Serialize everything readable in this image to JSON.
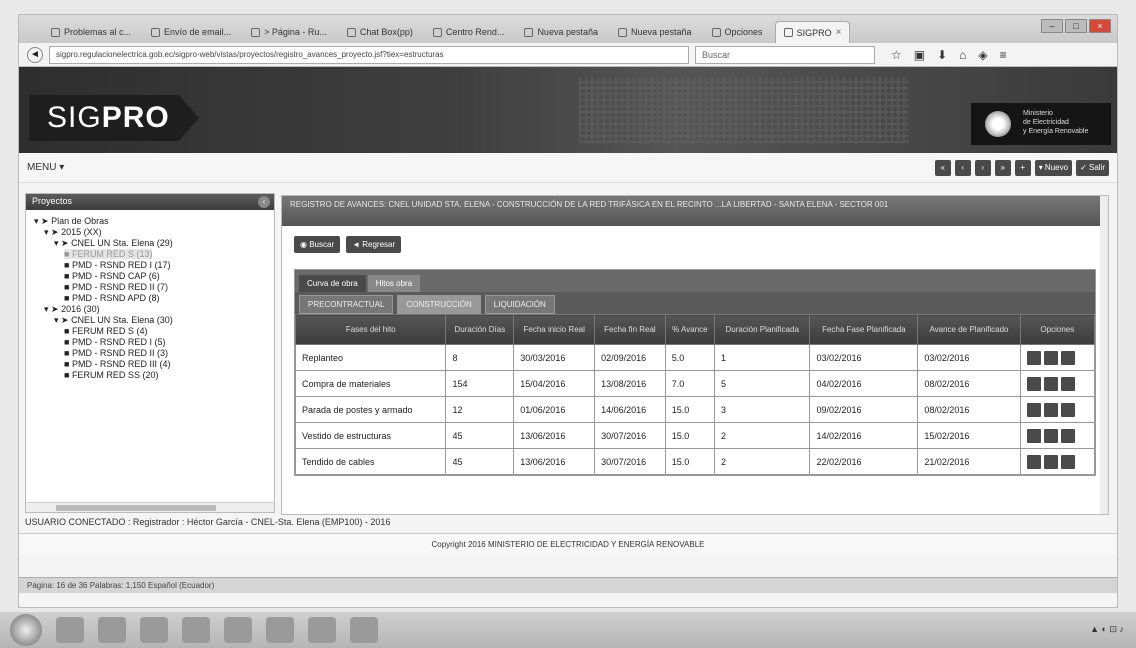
{
  "browser": {
    "tabs": [
      {
        "label": "Problemas al c..."
      },
      {
        "label": "Envío de email..."
      },
      {
        "label": "> Página - Ru..."
      },
      {
        "label": "Chat Box(pp)"
      },
      {
        "label": "Centro Rend..."
      },
      {
        "label": "Nueva pestaña"
      },
      {
        "label": "Nueva pestaña"
      },
      {
        "label": "Opciones"
      },
      {
        "label": "SIGPRO",
        "active": true
      }
    ],
    "url": "sigpro.regulacionelectrica.gob.ec/sigpro-web/vistas/proyectos/registro_avances_proyecto.jsf?tiex=estructuras",
    "search_placeholder": "Buscar"
  },
  "header": {
    "logo_prefix": "SIG",
    "logo_bold": "PRO",
    "ministry_lines": [
      "Ministerio",
      "de Electricidad",
      "y Energía Renovable"
    ]
  },
  "menubar": {
    "menu_label": "MENU ▾",
    "buttons": [
      "«",
      "‹",
      "›",
      "»",
      "+",
      "▾ Nuevo",
      "✓ Salir"
    ]
  },
  "left_panel": {
    "title": "Proyectos",
    "tree": [
      {
        "label": "Plan de Obras",
        "depth": 0
      },
      {
        "label": "2015 (XX)",
        "depth": 1
      },
      {
        "label": "CNEL UN Sta. Elena (29)",
        "depth": 2
      },
      {
        "label": "FERUM RED S (13)",
        "depth": 3,
        "selected": true
      },
      {
        "label": "PMD - RSND RED I (17)",
        "depth": 3
      },
      {
        "label": "PMD - RSND CAP (6)",
        "depth": 3
      },
      {
        "label": "PMD - RSND RED II (7)",
        "depth": 3
      },
      {
        "label": "PMD - RSND APD (8)",
        "depth": 3
      },
      {
        "label": "2016 (30)",
        "depth": 1
      },
      {
        "label": "CNEL UN Sta. Elena (30)",
        "depth": 2
      },
      {
        "label": "FERUM RED S (4)",
        "depth": 3
      },
      {
        "label": "PMD - RSND RED I (5)",
        "depth": 3
      },
      {
        "label": "PMD - RSND RED II (3)",
        "depth": 3
      },
      {
        "label": "PMD - RSND RED III (4)",
        "depth": 3
      },
      {
        "label": "FERUM RED SS (20)",
        "depth": 3
      }
    ]
  },
  "main": {
    "title": "REGISTRO DE AVANCES: CNEL UNIDAD STA. ELENA - CONSTRUCCIÓN DE LA RED TRIFÁSICA EN EL RECINTO ...LA LIBERTAD - SANTA ELENA - SECTOR 001",
    "action_buttons": [
      "Buscar",
      "Regresar"
    ],
    "tabs_level1": [
      {
        "label": "Curva de obra",
        "active": true
      },
      {
        "label": "Hitos obra",
        "active": false
      }
    ],
    "tabs_level2": [
      {
        "label": "PRECONTRACTUAL",
        "active": false
      },
      {
        "label": "CONSTRUCCIÓN",
        "active": true
      },
      {
        "label": "LIQUIDACIÓN",
        "active": false
      }
    ],
    "columns": [
      "Fases del hito",
      "Duración Días",
      "Fecha inicio Real",
      "Fecha fin Real",
      "% Avance",
      "Duración Planificada",
      "Fecha Fase Planificada",
      "Avance de Planificado",
      "Opciones"
    ],
    "rows": [
      [
        "Replanteo",
        "8",
        "30/03/2016",
        "02/09/2016",
        "5.0",
        "1",
        "03/02/2016",
        "03/02/2016"
      ],
      [
        "Compra de materiales",
        "154",
        "15/04/2016",
        "13/08/2016",
        "7.0",
        "5",
        "04/02/2016",
        "08/02/2016"
      ],
      [
        "Parada de postes y armado",
        "12",
        "01/06/2016",
        "14/06/2016",
        "15.0",
        "3",
        "09/02/2016",
        "08/02/2016"
      ],
      [
        "Vestido de estructuras",
        "45",
        "13/06/2016",
        "30/07/2016",
        "15.0",
        "2",
        "14/02/2016",
        "15/02/2016"
      ],
      [
        "Tendido de cables",
        "45",
        "13/06/2016",
        "30/07/2016",
        "15.0",
        "2",
        "22/02/2016",
        "21/02/2016"
      ]
    ]
  },
  "footer": {
    "status": "USUARIO CONECTADO : Registrador : Héctor García - CNEL-Sta. Elena (EMP100) - 2016",
    "copyright": "Copyright 2016 MINISTERIO DE ELECTRICIDAD Y ENERGÍA RENOVABLE",
    "pdfbar": "Página: 16 de 36    Palabras: 1,150    Español (Ecuador)"
  },
  "colors": {
    "banner": "#3a3a3a",
    "header_dark": "#4a4a4a"
  }
}
